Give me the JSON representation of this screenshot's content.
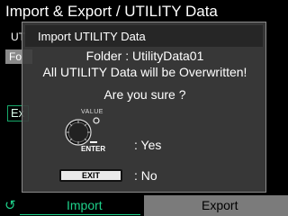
{
  "screen": {
    "title": "Import & Export / UTILITY Data",
    "bg_row_1": "UT",
    "bg_folder_row": "Fo",
    "bg_exec": "Ex"
  },
  "dialog": {
    "title": "Import UTILITY Data",
    "folder_line": "Folder : UtilityData01",
    "warning_line": "All UTILITY Data will be Overwritten!",
    "question": "Are you sure ?",
    "value_label": "VALUE",
    "enter_label": "ENTER",
    "yes_label": ": Yes",
    "exit_label": "EXIT",
    "no_label": ": No"
  },
  "footer": {
    "tabs": [
      {
        "label": "Import",
        "active": true
      },
      {
        "label": "Export",
        "active": false
      }
    ],
    "cycle_icon": "↺"
  },
  "colors": {
    "accent": "#1ed08a",
    "dialog_bg": "#3c3c3c",
    "dialog_title_bg": "#262626",
    "inactive_tab": "#7b7b7b"
  }
}
